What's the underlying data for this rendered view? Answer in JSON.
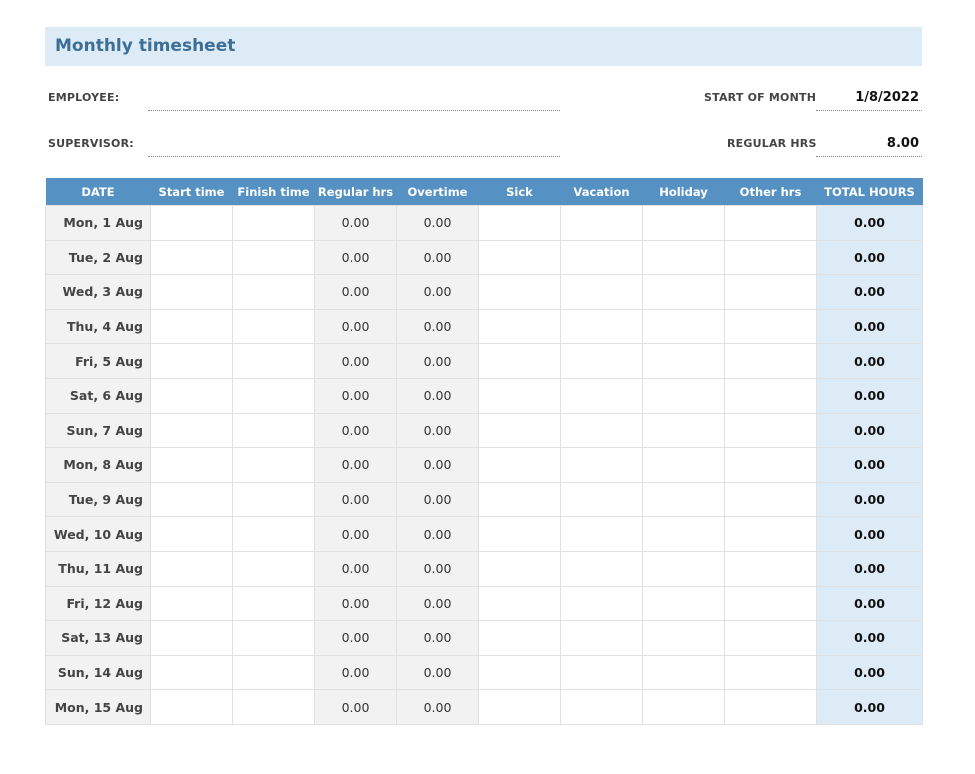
{
  "title": "Monthly timesheet",
  "header": {
    "employee_label": "EMPLOYEE:",
    "employee_value": "",
    "supervisor_label": "SUPERVISOR:",
    "supervisor_value": "",
    "start_label": "START OF MONTH",
    "start_value": "1/8/2022",
    "regular_label": "REGULAR HRS",
    "regular_value": "8.00"
  },
  "columns": [
    "DATE",
    "Start time",
    "Finish time",
    "Regular hrs",
    "Overtime",
    "Sick",
    "Vacation",
    "Holiday",
    "Other hrs",
    "TOTAL HOURS"
  ],
  "rows": [
    {
      "date": "Mon, 1 Aug",
      "start": "",
      "finish": "",
      "regular": "0.00",
      "overtime": "0.00",
      "sick": "",
      "vacation": "",
      "holiday": "",
      "other": "",
      "total": "0.00"
    },
    {
      "date": "Tue, 2 Aug",
      "start": "",
      "finish": "",
      "regular": "0.00",
      "overtime": "0.00",
      "sick": "",
      "vacation": "",
      "holiday": "",
      "other": "",
      "total": "0.00"
    },
    {
      "date": "Wed, 3 Aug",
      "start": "",
      "finish": "",
      "regular": "0.00",
      "overtime": "0.00",
      "sick": "",
      "vacation": "",
      "holiday": "",
      "other": "",
      "total": "0.00"
    },
    {
      "date": "Thu, 4 Aug",
      "start": "",
      "finish": "",
      "regular": "0.00",
      "overtime": "0.00",
      "sick": "",
      "vacation": "",
      "holiday": "",
      "other": "",
      "total": "0.00"
    },
    {
      "date": "Fri, 5 Aug",
      "start": "",
      "finish": "",
      "regular": "0.00",
      "overtime": "0.00",
      "sick": "",
      "vacation": "",
      "holiday": "",
      "other": "",
      "total": "0.00"
    },
    {
      "date": "Sat, 6 Aug",
      "start": "",
      "finish": "",
      "regular": "0.00",
      "overtime": "0.00",
      "sick": "",
      "vacation": "",
      "holiday": "",
      "other": "",
      "total": "0.00"
    },
    {
      "date": "Sun, 7 Aug",
      "start": "",
      "finish": "",
      "regular": "0.00",
      "overtime": "0.00",
      "sick": "",
      "vacation": "",
      "holiday": "",
      "other": "",
      "total": "0.00"
    },
    {
      "date": "Mon, 8 Aug",
      "start": "",
      "finish": "",
      "regular": "0.00",
      "overtime": "0.00",
      "sick": "",
      "vacation": "",
      "holiday": "",
      "other": "",
      "total": "0.00"
    },
    {
      "date": "Tue, 9 Aug",
      "start": "",
      "finish": "",
      "regular": "0.00",
      "overtime": "0.00",
      "sick": "",
      "vacation": "",
      "holiday": "",
      "other": "",
      "total": "0.00"
    },
    {
      "date": "Wed, 10 Aug",
      "start": "",
      "finish": "",
      "regular": "0.00",
      "overtime": "0.00",
      "sick": "",
      "vacation": "",
      "holiday": "",
      "other": "",
      "total": "0.00"
    },
    {
      "date": "Thu, 11 Aug",
      "start": "",
      "finish": "",
      "regular": "0.00",
      "overtime": "0.00",
      "sick": "",
      "vacation": "",
      "holiday": "",
      "other": "",
      "total": "0.00"
    },
    {
      "date": "Fri, 12 Aug",
      "start": "",
      "finish": "",
      "regular": "0.00",
      "overtime": "0.00",
      "sick": "",
      "vacation": "",
      "holiday": "",
      "other": "",
      "total": "0.00"
    },
    {
      "date": "Sat, 13 Aug",
      "start": "",
      "finish": "",
      "regular": "0.00",
      "overtime": "0.00",
      "sick": "",
      "vacation": "",
      "holiday": "",
      "other": "",
      "total": "0.00"
    },
    {
      "date": "Sun, 14 Aug",
      "start": "",
      "finish": "",
      "regular": "0.00",
      "overtime": "0.00",
      "sick": "",
      "vacation": "",
      "holiday": "",
      "other": "",
      "total": "0.00"
    },
    {
      "date": "Mon, 15 Aug",
      "start": "",
      "finish": "",
      "regular": "0.00",
      "overtime": "0.00",
      "sick": "",
      "vacation": "",
      "holiday": "",
      "other": "",
      "total": "0.00"
    }
  ]
}
